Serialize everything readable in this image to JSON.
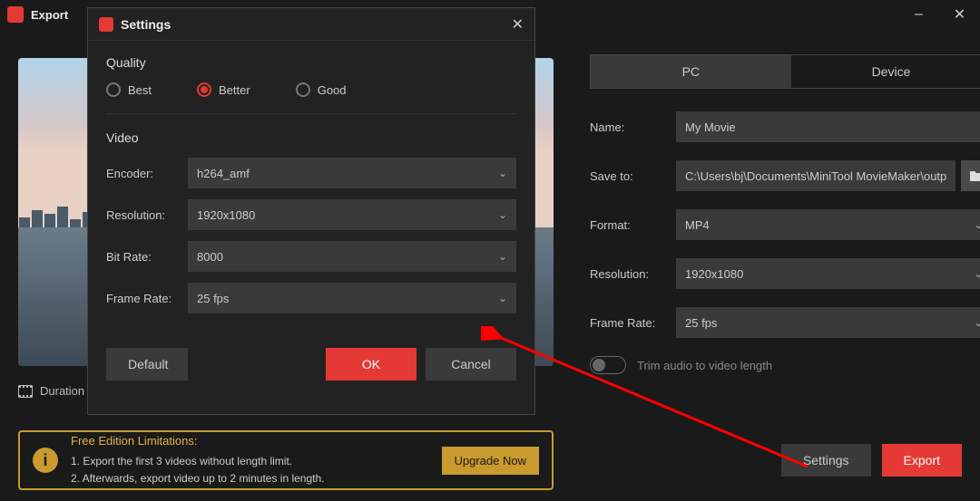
{
  "window": {
    "title": "Export",
    "minimize": "–",
    "close": "✕"
  },
  "preview": {
    "duration_label": "Duration"
  },
  "tabs": {
    "pc": "PC",
    "device": "Device"
  },
  "form": {
    "name_label": "Name:",
    "name_value": "My Movie",
    "saveto_label": "Save to:",
    "saveto_value": "C:\\Users\\bj\\Documents\\MiniTool MovieMaker\\outp",
    "format_label": "Format:",
    "format_value": "MP4",
    "resolution_label": "Resolution:",
    "resolution_value": "1920x1080",
    "framerate_label": "Frame Rate:",
    "framerate_value": "25 fps",
    "trim_label": "Trim audio to video length"
  },
  "limitations": {
    "title": "Free Edition Limitations:",
    "line1": "1. Export the first 3 videos without length limit.",
    "line2": "2. Afterwards, export video up to 2 minutes in length.",
    "upgrade": "Upgrade Now"
  },
  "footer": {
    "settings": "Settings",
    "export": "Export"
  },
  "dialog": {
    "title": "Settings",
    "quality": {
      "section": "Quality",
      "best": "Best",
      "better": "Better",
      "good": "Good",
      "selected": "better"
    },
    "video": {
      "section": "Video",
      "encoder_label": "Encoder:",
      "encoder_value": "h264_amf",
      "resolution_label": "Resolution:",
      "resolution_value": "1920x1080",
      "bitrate_label": "Bit Rate:",
      "bitrate_value": "8000",
      "framerate_label": "Frame Rate:",
      "framerate_value": "25 fps"
    },
    "buttons": {
      "default": "Default",
      "ok": "OK",
      "cancel": "Cancel"
    }
  }
}
